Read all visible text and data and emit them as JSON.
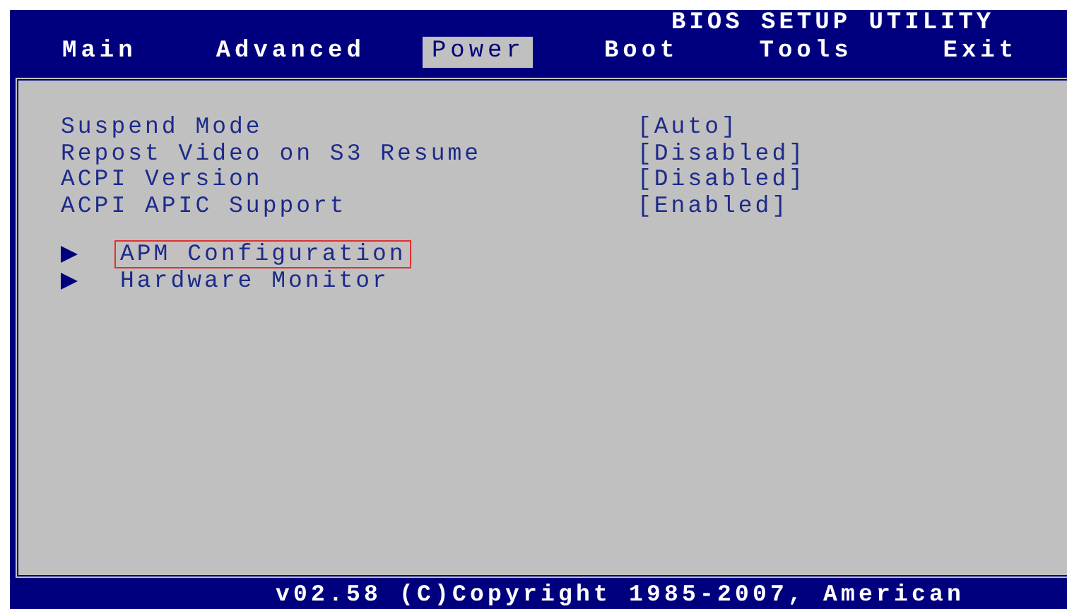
{
  "title": "BIOS SETUP UTILITY",
  "tabs": [
    {
      "label": "Main",
      "selected": false
    },
    {
      "label": "Advanced",
      "selected": false
    },
    {
      "label": "Power",
      "selected": true
    },
    {
      "label": "Boot",
      "selected": false
    },
    {
      "label": "Tools",
      "selected": false
    },
    {
      "label": "Exit",
      "selected": false
    }
  ],
  "items": [
    {
      "kind": "setting",
      "label": "Suspend Mode",
      "value": "[Auto]",
      "selected": false
    },
    {
      "kind": "setting",
      "label": "Repost Video on S3 Resume",
      "value": "[Disabled]",
      "selected": false
    },
    {
      "kind": "setting",
      "label": "ACPI Version",
      "value": "[Disabled]",
      "selected": false
    },
    {
      "kind": "setting",
      "label": "ACPI APIC Support",
      "value": "[Enabled]",
      "selected": false
    },
    {
      "kind": "submenu",
      "label": "APM Configuration",
      "selected": true
    },
    {
      "kind": "submenu",
      "label": "Hardware Monitor",
      "selected": false
    }
  ],
  "status_bar": "v02.58 (C)Copyright 1985-2007, American"
}
